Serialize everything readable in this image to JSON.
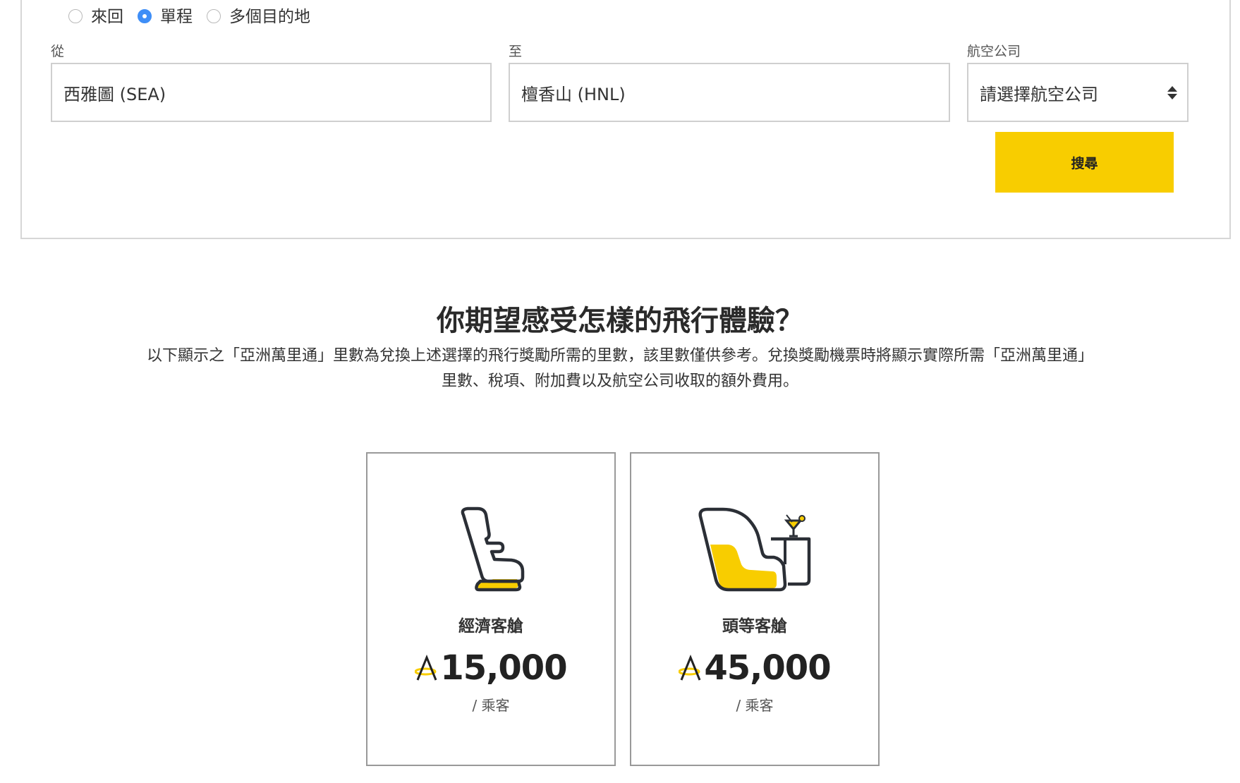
{
  "trip_type": {
    "options": [
      {
        "label": "來回",
        "checked": false
      },
      {
        "label": "單程",
        "checked": true
      },
      {
        "label": "多個目的地",
        "checked": false
      }
    ]
  },
  "from": {
    "label": "從",
    "value": "西雅圖 (SEA)"
  },
  "to": {
    "label": "至",
    "value": "檀香山 (HNL)"
  },
  "airline": {
    "label": "航空公司",
    "placeholder": "請選擇航空公司"
  },
  "search_button": {
    "label": "搜尋"
  },
  "section": {
    "title": "你期望感受怎樣的飛行體驗？",
    "description": "以下顯示之「亞洲萬里通」里數為兌換上述選擇的飛行獎勵所需的里數，該里數僅供參考。兌換獎勵機票時將顯示實際所需「亞洲萬里通」里數、稅項、附加費以及航空公司收取的額外費用。"
  },
  "cabins": [
    {
      "name": "經濟客艙",
      "miles": "15,000",
      "per": "/ 乘客",
      "icon": "economy-seat-icon"
    },
    {
      "name": "頭等客艙",
      "miles": "45,000",
      "per": "/ 乘客",
      "icon": "first-class-seat-icon"
    }
  ],
  "colors": {
    "accent": "#f8cd00",
    "radio": "#3e8ef7",
    "icon_stroke": "#2b2f36"
  }
}
